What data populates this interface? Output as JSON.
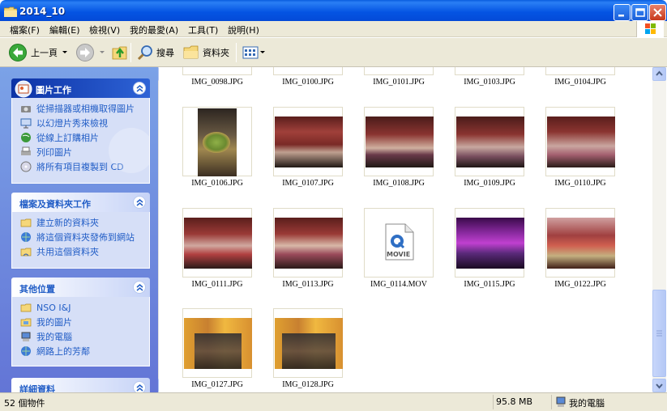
{
  "window": {
    "title": "2014_10"
  },
  "menu": {
    "items": [
      "檔案(F)",
      "編輯(E)",
      "檢視(V)",
      "我的最愛(A)",
      "工具(T)",
      "說明(H)"
    ]
  },
  "toolbar": {
    "back_label": "上一頁",
    "search_label": "搜尋",
    "folders_label": "資料夾"
  },
  "sidebar": {
    "picture_tasks": {
      "title": "圖片工作",
      "items": [
        "從掃描器或相機取得圖片",
        "以幻燈片秀來檢視",
        "從線上訂購相片",
        "列印圖片",
        "將所有項目複製到 CD"
      ]
    },
    "file_tasks": {
      "title": "檔案及資料夾工作",
      "items": [
        "建立新的資料夾",
        "將這個資料夾發佈到網站",
        "共用這個資料夾"
      ]
    },
    "other_places": {
      "title": "其他位置",
      "items": [
        "NSO I&J",
        "我的圖片",
        "我的電腦",
        "網路上的芳鄰"
      ]
    },
    "details": {
      "title": "詳細資料"
    }
  },
  "files": {
    "top_row": [
      "IMG_0098.JPG",
      "IMG_0100.JPG",
      "IMG_0101.JPG",
      "IMG_0103.JPG",
      "IMG_0104.JPG"
    ],
    "items": [
      "IMG_0106.JPG",
      "IMG_0107.JPG",
      "IMG_0108.JPG",
      "IMG_0109.JPG",
      "IMG_0110.JPG",
      "IMG_0111.JPG",
      "IMG_0113.JPG",
      "IMG_0114.MOV",
      "IMG_0115.JPG",
      "IMG_0122.JPG",
      "IMG_0127.JPG",
      "IMG_0128.JPG"
    ],
    "movie_badge": "MOVIE"
  },
  "status": {
    "count": "52 個物件",
    "size": "95.8 MB",
    "location": "我的電腦"
  },
  "colors": {
    "titlebar": "#0454e3",
    "sidebar_bg": "#6f8fdf",
    "task_link": "#215dc6"
  }
}
